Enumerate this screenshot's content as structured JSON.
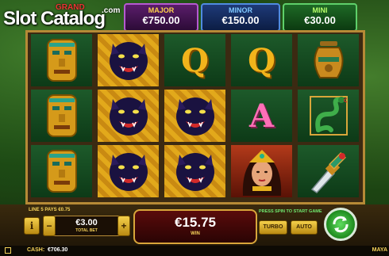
{
  "logo": {
    "grand": "GRAND",
    "slot": "Slot Catalog",
    "com": ".com"
  },
  "jackpots": [
    {
      "name": "MAJOR",
      "value": "€750.00"
    },
    {
      "name": "MINOR",
      "value": "€150.00"
    },
    {
      "name": "MINI",
      "value": "€30.00"
    }
  ],
  "reels": [
    [
      "mask-icon",
      "mask-icon",
      "mask-icon"
    ],
    [
      "panther-icon",
      "panther-icon",
      "panther-icon"
    ],
    [
      "Q",
      "panther-icon",
      "panther-icon"
    ],
    [
      "Q",
      "A",
      "queen-icon"
    ],
    [
      "urn-icon",
      "snake-icon",
      "dagger-icon"
    ]
  ],
  "bottom": {
    "line_info": "LINE 5 PAYS €0.75",
    "bet_value": "€3.00",
    "bet_label": "TOTAL BET",
    "win_value": "€15.75",
    "win_label": "WIN",
    "press_spin": "PRESS SPIN TO START GAME",
    "turbo": "TURBO",
    "auto": "AUTO",
    "cash_label": "CASH:",
    "cash_value": "€706.30",
    "brand": "MAYA",
    "info": "i",
    "minus": "−",
    "plus": "+"
  }
}
